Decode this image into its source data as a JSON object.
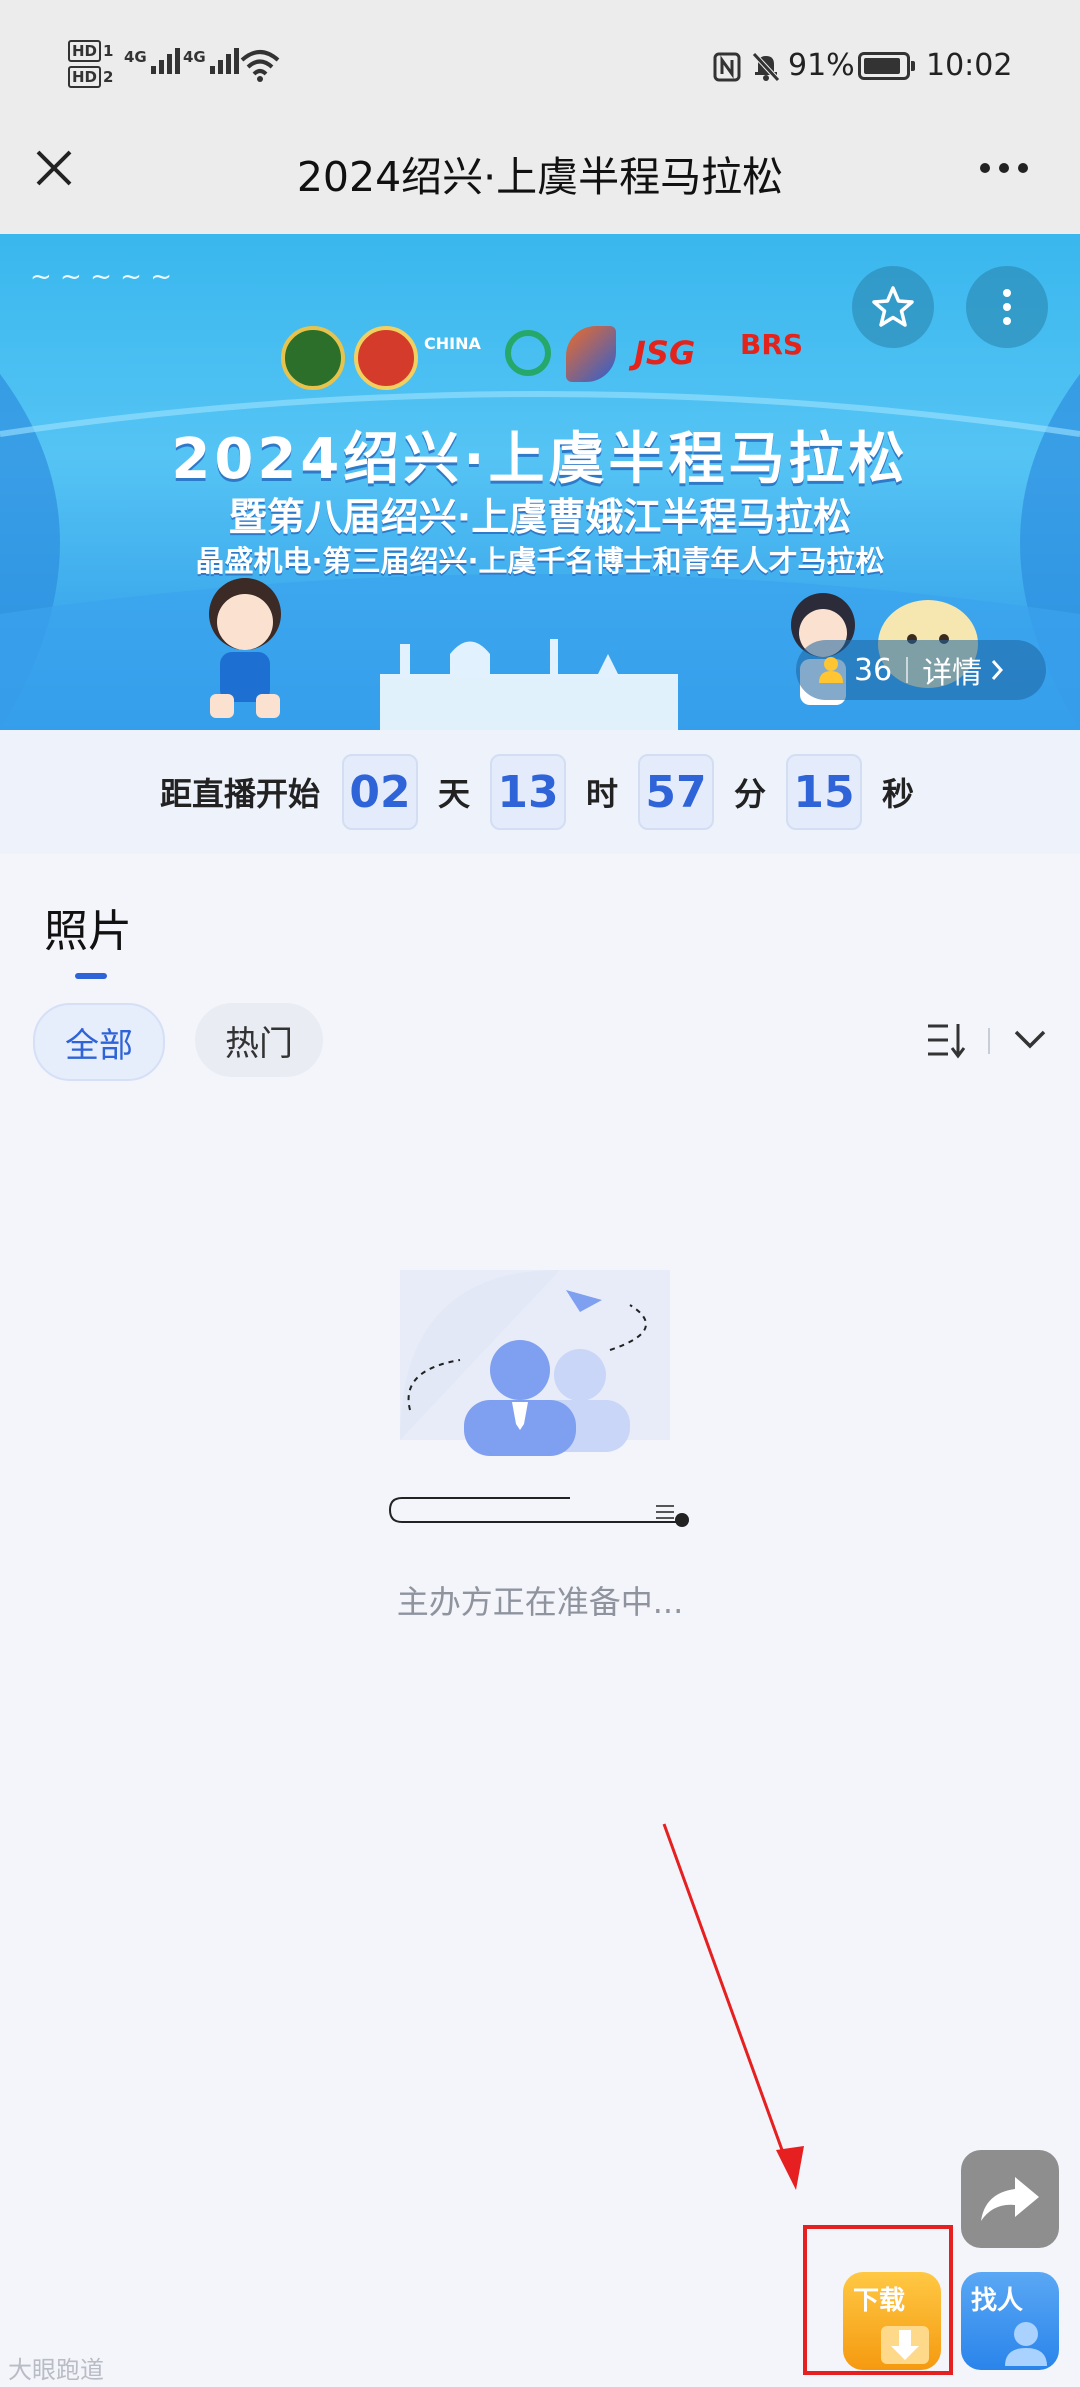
{
  "status_bar": {
    "sim1": "HD",
    "sim1_num": "1",
    "sim2": "HD",
    "sim2_num": "2",
    "net1": "4G",
    "net2": "4G",
    "battery": "91%",
    "battery_level": 0.91,
    "time": "10:02"
  },
  "titlebar": {
    "title": "2024绍兴·上虞半程马拉松"
  },
  "banner": {
    "line1": "2024绍兴·上虞半程马拉松",
    "line2": "暨第八届绍兴·上虞曹娥江半程马拉松",
    "line3": "晶盛机电·第三届绍兴·上虞千名博士和青年人才马拉松",
    "jsg_logo": "JSG",
    "brs_logo": "BRS",
    "viewer_count": "36",
    "details_label": "详情",
    "colors": {
      "sky": "#39b7ee",
      "deep": "#2a95e6"
    }
  },
  "countdown": {
    "label": "距直播开始",
    "days": "02",
    "days_unit": "天",
    "hours": "13",
    "hours_unit": "时",
    "minutes": "57",
    "minutes_unit": "分",
    "seconds": "15",
    "seconds_unit": "秒"
  },
  "content": {
    "heading": "照片",
    "filters": [
      "全部",
      "热门"
    ],
    "active_filter": "全部",
    "empty_message": "主办方正在准备中..."
  },
  "fabs": {
    "download_label": "下载",
    "find_label": "找人"
  },
  "watermark": "大眼跑道",
  "colors": {
    "accent": "#2f63d8",
    "annotation": "#e62020"
  }
}
